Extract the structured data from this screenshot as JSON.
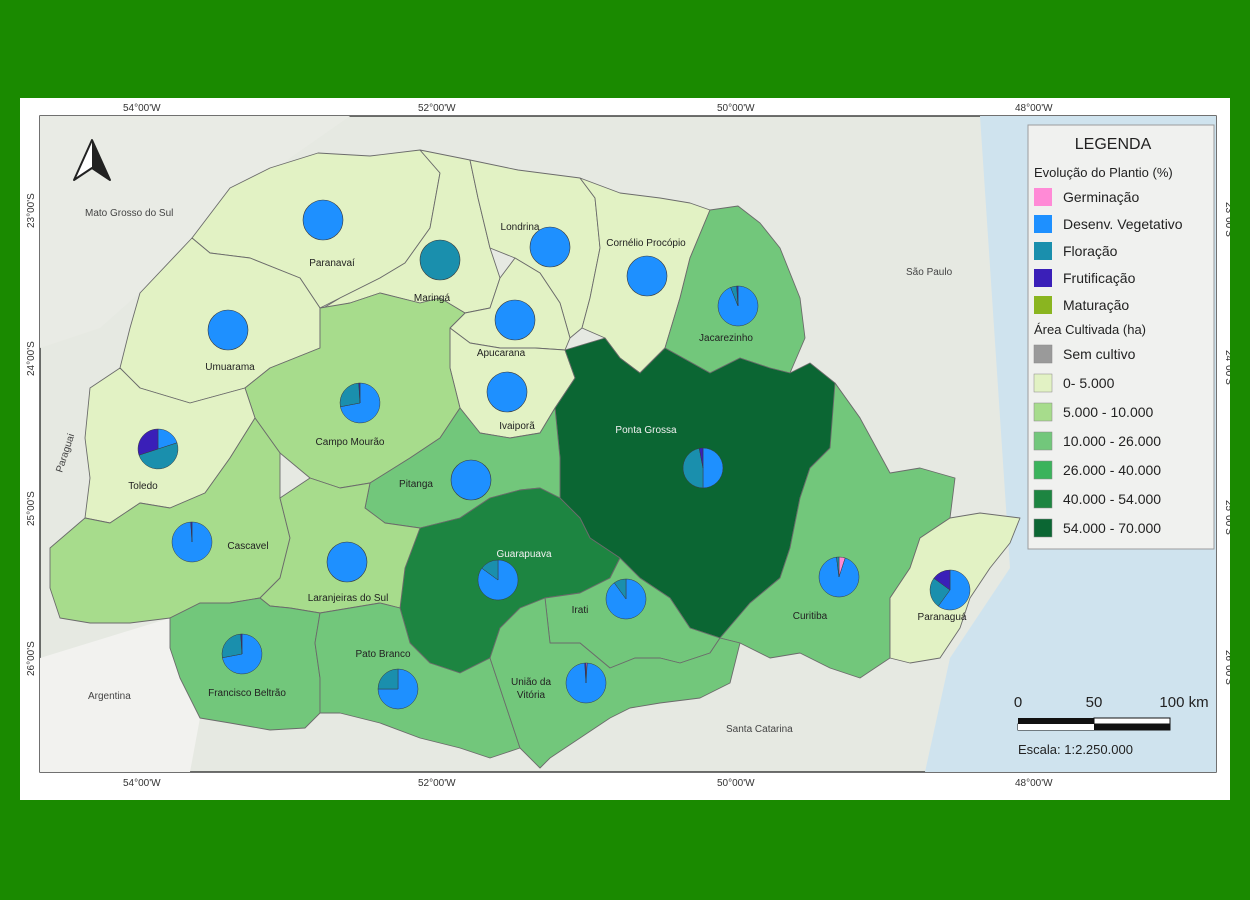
{
  "graticule": {
    "lon": [
      "54°00'W",
      "52°00'W",
      "50°00'W",
      "48°00'W"
    ],
    "lat": [
      "23°00'S",
      "24°00'S",
      "25°00'S",
      "26°00'S"
    ]
  },
  "neighbors": {
    "ms": "Mato Grosso do Sul",
    "sp": "São Paulo",
    "py": "Paraguai",
    "ar": "Argentina",
    "sc": "Santa Catarina"
  },
  "regions": [
    {
      "name": "Paranavaí",
      "area_class": "0- 5.000",
      "fill": "#e2f2c4",
      "pie": {
        "desenv": 100
      }
    },
    {
      "name": "Maringá",
      "area_class": "0- 5.000",
      "fill": "#e2f2c4",
      "pie": {
        "floracao": 100
      }
    },
    {
      "name": "Londrina",
      "area_class": "0- 5.000",
      "fill": "#e2f2c4",
      "pie": {
        "desenv": 100
      }
    },
    {
      "name": "Cornélio Procópio",
      "area_class": "0- 5.000",
      "fill": "#e2f2c4",
      "pie": {
        "desenv": 100
      }
    },
    {
      "name": "Jacarezinho",
      "area_class": "10.000 - 26.000",
      "fill": "#72c77b",
      "pie": {
        "desenv": 94,
        "floracao": 5,
        "frutificacao": 1
      }
    },
    {
      "name": "Apucarana",
      "area_class": "0- 5.000",
      "fill": "#e2f2c4",
      "pie": {
        "desenv": 100
      }
    },
    {
      "name": "Umuarama",
      "area_class": "0- 5.000",
      "fill": "#e2f2c4",
      "pie": {
        "desenv": 100
      }
    },
    {
      "name": "Ivaiporã",
      "area_class": "0- 5.000",
      "fill": "#e2f2c4",
      "pie": {
        "desenv": 100
      }
    },
    {
      "name": "Campo Mourão",
      "area_class": "5.000 - 10.000",
      "fill": "#a7dc8c",
      "pie": {
        "desenv": 72,
        "floracao": 27,
        "frutificacao": 1
      }
    },
    {
      "name": "Toledo",
      "area_class": "0- 5.000",
      "fill": "#e2f2c4",
      "pie": {
        "desenv": 20,
        "floracao": 50,
        "frutificacao": 30
      }
    },
    {
      "name": "Ponta Grossa",
      "area_class": "54.000 - 70.000",
      "fill": "#0b6633",
      "pie": {
        "desenv": 50,
        "floracao": 47,
        "frutificacao": 3
      }
    },
    {
      "name": "Pitanga",
      "area_class": "10.000 - 26.000",
      "fill": "#72c77b",
      "pie": {
        "desenv": 100
      }
    },
    {
      "name": "Cascavel",
      "area_class": "5.000 - 10.000",
      "fill": "#a7dc8c",
      "pie": {
        "desenv": 99,
        "frutificacao": 1
      }
    },
    {
      "name": "Guarapuava",
      "area_class": "40.000 - 54.000",
      "fill": "#1d8541",
      "pie": {
        "desenv": 85,
        "floracao": 15
      }
    },
    {
      "name": "Laranjeiras do Sul",
      "area_class": "5.000 - 10.000",
      "fill": "#a7dc8c",
      "pie": {
        "desenv": 100
      }
    },
    {
      "name": "Curitiba",
      "area_class": "10.000 - 26.000",
      "fill": "#72c77b",
      "pie": {
        "germinacao": 5,
        "desenv": 93,
        "floracao": 2
      }
    },
    {
      "name": "Irati",
      "area_class": "10.000 - 26.000",
      "fill": "#72c77b",
      "pie": {
        "desenv": 90,
        "floracao": 10
      }
    },
    {
      "name": "Paranaguá",
      "area_class": "0- 5.000",
      "fill": "#e2f2c4",
      "pie": {
        "desenv": 60,
        "floracao": 25,
        "frutificacao": 15
      }
    },
    {
      "name": "Francisco Beltrão",
      "area_class": "10.000 - 26.000",
      "fill": "#72c77b",
      "pie": {
        "desenv": 72,
        "floracao": 27,
        "frutificacao": 1
      }
    },
    {
      "name": "Pato Branco",
      "area_class": "10.000 - 26.000",
      "fill": "#72c77b",
      "pie": {
        "desenv": 75,
        "floracao": 25
      }
    },
    {
      "name": "União da Vitória",
      "area_class": "10.000 - 26.000",
      "fill": "#72c77b",
      "pie": {
        "germinacao": 1,
        "desenv": 98,
        "frutificacao": 1
      }
    }
  ],
  "legend": {
    "title": "LEGENDA",
    "section1_title": "Evolução do Plantio (%)",
    "phases": [
      {
        "key": "germinacao",
        "label": "Germinação",
        "color": "#ff8ad6"
      },
      {
        "key": "desenv",
        "label": "Desenv. Vegetativo",
        "color": "#1e90ff"
      },
      {
        "key": "floracao",
        "label": "Floração",
        "color": "#1a8fad"
      },
      {
        "key": "frutificacao",
        "label": "Frutificação",
        "color": "#3a1fb8"
      },
      {
        "key": "maturacao",
        "label": "Maturação",
        "color": "#8ab520"
      }
    ],
    "section2_title": "Área Cultivada (ha)",
    "area_classes": [
      {
        "label": "Sem cultivo",
        "color": "#9a9a9a"
      },
      {
        "label": "0- 5.000",
        "color": "#e2f2c4"
      },
      {
        "label": "5.000 - 10.000",
        "color": "#a7dc8c"
      },
      {
        "label": "10.000 - 26.000",
        "color": "#72c77b"
      },
      {
        "label": "26.000 - 40.000",
        "color": "#3bb35c"
      },
      {
        "label": "40.000 - 54.000",
        "color": "#1d8541"
      },
      {
        "label": "54.000 - 70.000",
        "color": "#0b6633"
      }
    ]
  },
  "scale": {
    "t0": "0",
    "t1": "50",
    "t2": "100 km",
    "text": "Escala: 1:2.250.000"
  }
}
